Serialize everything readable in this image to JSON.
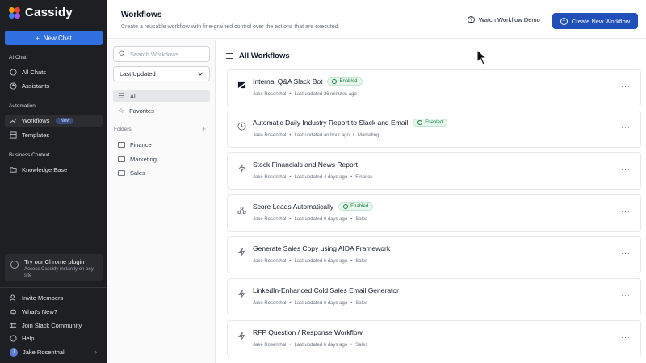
{
  "app": {
    "name": "Cassidy"
  },
  "sidebar": {
    "new_chat": "New Chat",
    "sections": {
      "ai_chat": "AI Chat",
      "automation": "Automation",
      "business_context": "Business Context"
    },
    "items": [
      {
        "label": "All Chats",
        "icon": "chat-icon"
      },
      {
        "label": "Assistants",
        "icon": "assistant-icon"
      },
      {
        "label": "Workflows",
        "icon": "workflow-icon",
        "badge": "New"
      },
      {
        "label": "Templates",
        "icon": "template-icon"
      },
      {
        "label": "Knowledge Base",
        "icon": "folder-icon"
      }
    ],
    "plugin": {
      "title": "Try our Chrome plugin",
      "subtitle": "Access Cassidy instantly on any site"
    },
    "bottom": [
      {
        "label": "Invite Members",
        "icon": "invite-icon"
      },
      {
        "label": "What's New?",
        "icon": "bell-icon"
      },
      {
        "label": "Join Slack Community",
        "icon": "slack-icon"
      },
      {
        "label": "Help",
        "icon": "help-icon"
      }
    ],
    "user": {
      "name": "Jake Rosenthal",
      "initial": "J"
    }
  },
  "header": {
    "title": "Workflows",
    "subtitle": "Create a reusable workflow with fine-grained control over the actions that are executed.",
    "demo_link": "Watch Workflow Demo",
    "create_button": "Create New Workflow"
  },
  "filters": {
    "search_placeholder": "Search Workflows",
    "sort_value": "Last Updated",
    "items": [
      {
        "label": "All"
      },
      {
        "label": "Favorites"
      }
    ],
    "folders_label": "Folders",
    "folders": [
      {
        "label": "Finance"
      },
      {
        "label": "Marketing"
      },
      {
        "label": "Sales"
      }
    ]
  },
  "main": {
    "heading": "All Workflows",
    "workflows": [
      {
        "title": "Internal Q&A Slack Bot",
        "icon": "zendesk-icon",
        "enabled": "Enabled",
        "author": "Jake Rosenthal",
        "updated": "Last updated 36 minutes ago",
        "folder": ""
      },
      {
        "title": "Automatic Daily Industry Report to Slack and Email",
        "icon": "clock-icon",
        "enabled": "Enabled",
        "author": "Jake Rosenthal",
        "updated": "Last updated an hour ago",
        "folder": "Marketing"
      },
      {
        "title": "Stock Financials and News Report",
        "icon": "lightning-icon",
        "enabled": "",
        "author": "Jake Rosenthal",
        "updated": "Last updated 4 days ago",
        "folder": "Finance"
      },
      {
        "title": "Score Leads Automatically",
        "icon": "webhook-icon",
        "enabled": "Enabled",
        "author": "Jake Rosenthal",
        "updated": "Last updated 6 days ago",
        "folder": "Sales"
      },
      {
        "title": "Generate Sales Copy using AIDA Framework",
        "icon": "lightning-icon",
        "enabled": "",
        "author": "Jake Rosenthal",
        "updated": "Last updated 6 days ago",
        "folder": "Sales"
      },
      {
        "title": "LinkedIn-Enhanced Cold Sales Email Generator",
        "icon": "lightning-icon",
        "enabled": "",
        "author": "Jake Rosenthal",
        "updated": "Last updated 6 days ago",
        "folder": "Sales"
      },
      {
        "title": "RFP Question / Response Workflow",
        "icon": "lightning-icon",
        "enabled": "",
        "author": "Jake Rosenthal",
        "updated": "Last updated 6 days ago",
        "folder": "Sales"
      }
    ],
    "more_label": "···",
    "bullet": "•"
  },
  "colors": {
    "sidebar_bg": "#1e1f22",
    "accent": "#2f6fe0",
    "create_button": "#1f4fb8",
    "enabled_green": "#15803d"
  }
}
